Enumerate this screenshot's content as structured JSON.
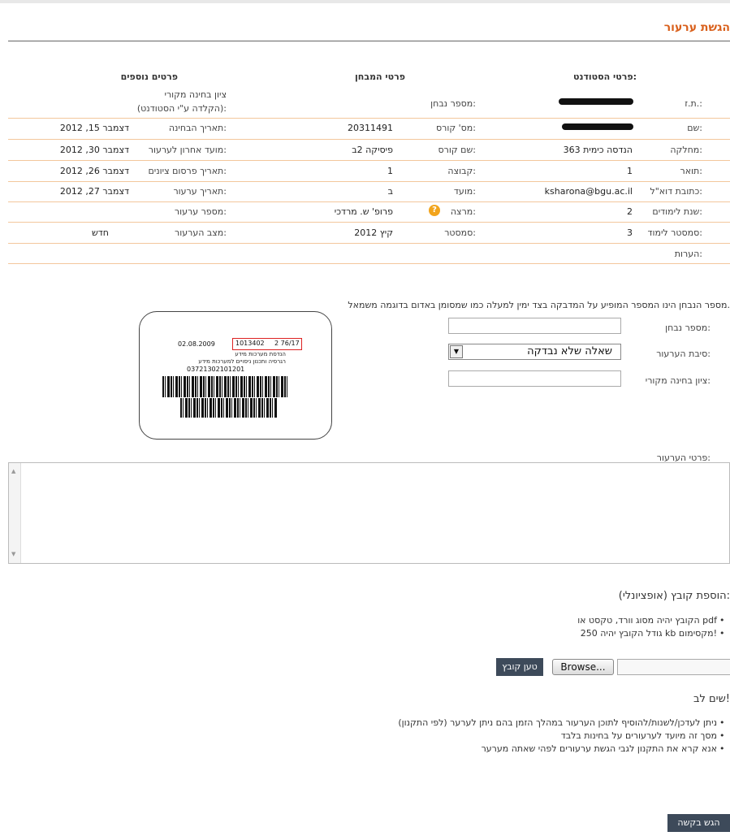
{
  "page_title": "הגשת ערעור",
  "sections": {
    "student": "פרטי הסטודנט:",
    "exam": "פרטי המבחן",
    "extra": "פרטים נוספים"
  },
  "student": {
    "id_label": "ת.ז.:",
    "name_label": "שם:",
    "department_label": "מחלקה:",
    "department_value": "363 הנדסה כימית",
    "degree_label": "תואר:",
    "degree_value": "1",
    "email_label": "כתובת דוא\"ל:",
    "email_value": "ksharona@bgu.ac.il",
    "year_label": "שנת לימודים:",
    "year_value": "2",
    "semester_label": "סמסטר לימוד:",
    "semester_value": "3",
    "notes_label": "הערות:"
  },
  "exam": {
    "exam_number_label": "מספר נבחן:",
    "course_number_label": "מס' קורס:",
    "course_number_value": "20311491",
    "course_name_label": "שם קורס:",
    "course_name_value": "פיסיקה 2ב",
    "group_label": "קבוצה:",
    "group_value": "1",
    "moed_label": "מועד:",
    "moed_value": "ב",
    "lecturer_label": "מרצה:",
    "lecturer_value": "פרופ' ש. מרדכי",
    "lecturer_icon": "help-icon",
    "semester_label": "סמסטר:",
    "semester_value": "קיץ 2012"
  },
  "extra": {
    "original_grade_label_1": "ציון בחינה מקורי",
    "original_grade_label_2": "(הקלדה ע\"י הסטודנט):",
    "exam_date_label": "תאריך הבחינה:",
    "exam_date_value": "דצמבר 15, 2012",
    "deadline_label": "מועד אחרון לערעור:",
    "deadline_value": "דצמבר 30, 2012",
    "grades_pub_label": "תאריך פרסום ציונים:",
    "grades_pub_value": "דצמבר 26, 2012",
    "appeal_date_label": "תאריך ערעור:",
    "appeal_date_value": "דצמבר 27, 2012",
    "appeal_number_label": "מספר ערעור:",
    "appeal_status_label": "מצב הערעור:",
    "appeal_status_value": "חדש"
  },
  "form": {
    "instruction": "מספר הנבחן הינו המספר המופיע על המדבקה בצד ימין למעלה כמו שמסומן באדום בדוגמה משמאל.",
    "exam_number_label": "מספר נבחן:",
    "exam_number_value": "",
    "reason_label": "סיבת הערעור:",
    "reason_selected": "שאלה שלא נבדקה",
    "original_grade_label": "ציון בחינה מקורי:",
    "original_grade_value": "",
    "details_label": "פרטי הערעור:",
    "details_value": ""
  },
  "sticker": {
    "date": "02.08.2009",
    "number": "1013402",
    "code": "2  76/17",
    "line1": "הנדסת מערכות מידע",
    "line2": "רגרסיה ותכנון ניסויים למערכות מידע",
    "barcode_number": "03721302101201"
  },
  "upload": {
    "title": "הוספת קובץ (אופציונלי):",
    "bullet1": "הקובץ יהיה מסוג וורד, טקסט או pdf",
    "bullet2": "גודל הקובץ יהיה 250 kb מקסימום!",
    "browse_label": "Browse...",
    "upload_label": "טען קובץ"
  },
  "notice": {
    "title": "שים לב!",
    "bullet1": "ניתן לעדכן/לשנות/להוסיף לתוכן הערעור במהלך הזמן בהם ניתן לערער (לפי התקנון)",
    "bullet2": "מסך זה מיועד לערעורים על בחינות בלבד",
    "bullet3": "אנא קרא את התקנון לגבי הגשת ערעורים לפהי שאתה מערער"
  },
  "submit_label": "הגש בקשה"
}
